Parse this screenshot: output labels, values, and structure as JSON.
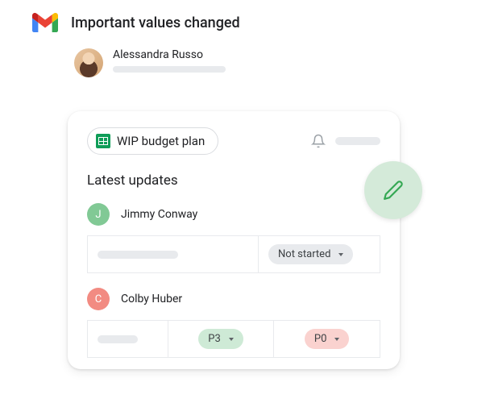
{
  "header": {
    "title": "Important values changed"
  },
  "sender": {
    "name": "Alessandra Russo"
  },
  "card": {
    "chip_label": "WIP budget plan",
    "section_title": "Latest updates"
  },
  "updates": [
    {
      "initial": "J",
      "name": "Jimmy Conway",
      "status": {
        "label": "Not started"
      }
    },
    {
      "initial": "C",
      "name": "Colby Huber",
      "priority_a": {
        "label": "P3"
      },
      "priority_b": {
        "label": "P0"
      }
    }
  ]
}
